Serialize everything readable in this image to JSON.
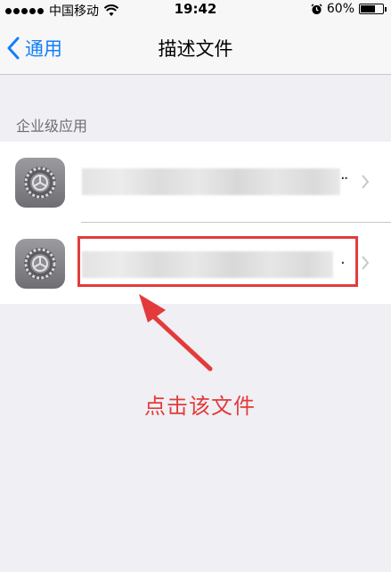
{
  "status_bar": {
    "carrier": "中国移动",
    "time": "19:42",
    "battery": "60%",
    "battery_level": 0.6
  },
  "nav": {
    "back_label": "通用",
    "title": "描述文件"
  },
  "section": {
    "header": "企业级应用",
    "items": [
      {
        "icon": "settings-gear-icon",
        "label_visible": false,
        "trailing": ".."
      },
      {
        "icon": "settings-gear-icon",
        "label_visible": false,
        "trailing": "."
      }
    ]
  },
  "annotation": {
    "text": "点击该文件",
    "color": "#e33b3b"
  },
  "colors": {
    "accent": "#147efb",
    "background": "#efeff4"
  }
}
